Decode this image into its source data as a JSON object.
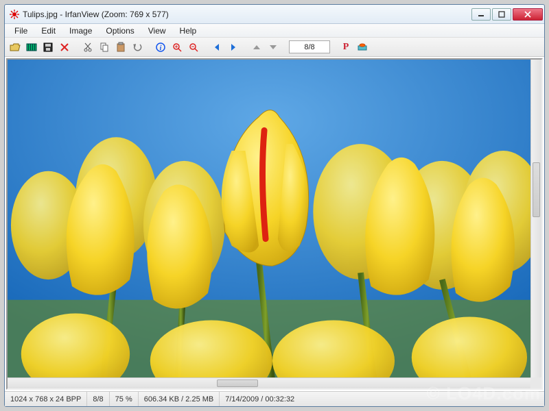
{
  "title": "Tulips.jpg - IrfanView (Zoom: 769 x 577)",
  "menu": {
    "file": "File",
    "edit": "Edit",
    "image": "Image",
    "options": "Options",
    "view": "View",
    "help": "Help"
  },
  "toolbar": {
    "counter": "8/8",
    "paint_label": "P"
  },
  "status": {
    "dims": "1024 x 768 x 24 BPP",
    "index": "8/8",
    "zoom": "75 %",
    "size": "606.34 KB / 2.25 MB",
    "date": "7/14/2009 / 00:32:32"
  },
  "watermark": "© LO4D.com",
  "colors": {
    "accent_red": "#c23",
    "link_blue": "#1e6fd8"
  }
}
